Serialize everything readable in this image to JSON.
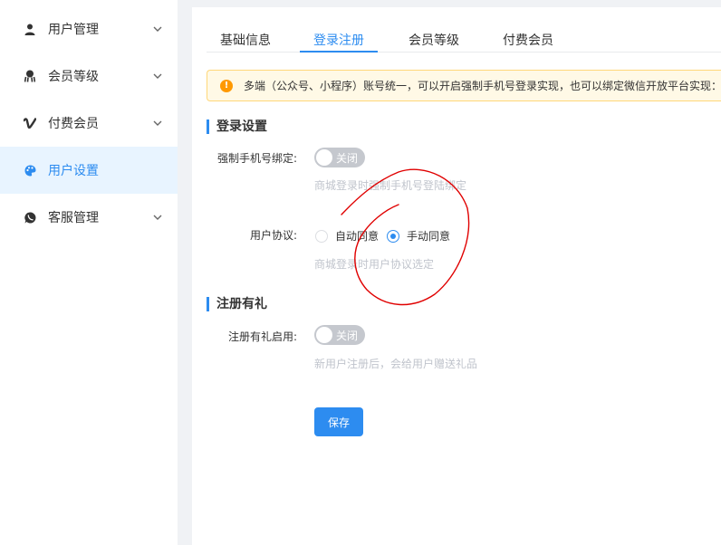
{
  "sidebar": {
    "items": [
      {
        "label": "用户管理",
        "icon": "user-icon",
        "has_chevron": true,
        "active": false
      },
      {
        "label": "会员等级",
        "icon": "member-level-icon",
        "has_chevron": true,
        "active": false
      },
      {
        "label": "付费会员",
        "icon": "vimeo-v-icon",
        "has_chevron": true,
        "active": false
      },
      {
        "label": "用户设置",
        "icon": "palette-icon",
        "has_chevron": false,
        "active": true
      },
      {
        "label": "客服管理",
        "icon": "whatsapp-icon",
        "has_chevron": true,
        "active": false
      }
    ]
  },
  "tabs": [
    {
      "label": "基础信息",
      "active": false
    },
    {
      "label": "登录注册",
      "active": true
    },
    {
      "label": "会员等级",
      "active": false
    },
    {
      "label": "付费会员",
      "active": false
    }
  ],
  "notice": {
    "text": "多端（公众号、小程序）账号统一，可以开启强制手机号登录实现，也可以绑定微信开放平台实现：微"
  },
  "login_section": {
    "title": "登录设置",
    "force_phone": {
      "label": "强制手机号绑定:",
      "switch_text": "关闭",
      "enabled": false,
      "help": "商城登录时强制手机号登陆绑定"
    },
    "agreement": {
      "label": "用户协议:",
      "options": [
        "自动同意",
        "手动同意"
      ],
      "selected": "手动同意",
      "help": "商城登录时用户协议选定"
    }
  },
  "register_section": {
    "title": "注册有礼",
    "gift_enabled": {
      "label": "注册有礼启用:",
      "switch_text": "关闭",
      "enabled": false,
      "help": "新用户注册后，会给用户赠送礼品"
    }
  },
  "save_label": "保存",
  "colors": {
    "primary": "#2d8cf0",
    "annotation": "#e00000",
    "warning": "#ff9900",
    "notice_bg": "#fff9e6"
  }
}
